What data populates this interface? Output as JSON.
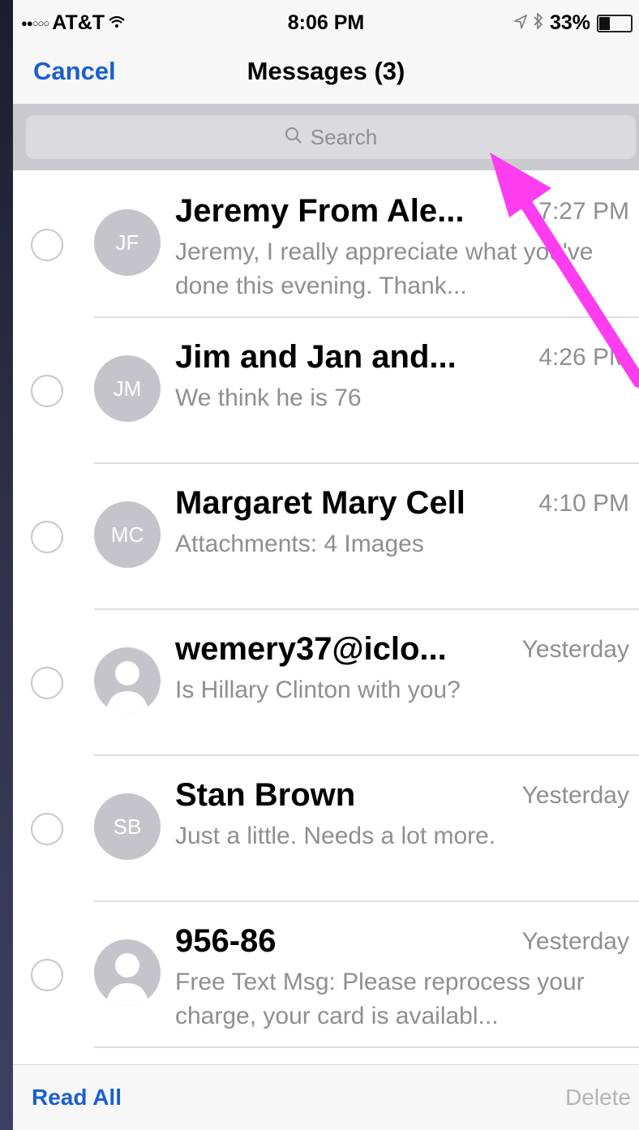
{
  "status_bar": {
    "signal": "●●○○○",
    "carrier": "AT&T",
    "time": "8:06 PM",
    "battery_percent": "33%",
    "battery_level": 0.33
  },
  "nav": {
    "cancel": "Cancel",
    "title": "Messages (3)"
  },
  "search": {
    "placeholder": "Search"
  },
  "conversations": [
    {
      "initials": "JF",
      "name": "Jeremy From Ale...",
      "time": "7:27 PM",
      "preview": "Jeremy, I really appreciate what you've done this evening. Thank..."
    },
    {
      "initials": "JM",
      "name": "Jim and Jan and...",
      "time": "4:26 PM",
      "preview": "We think he is 76"
    },
    {
      "initials": "MC",
      "name": "Margaret Mary Cell",
      "time": "4:10 PM",
      "preview": "Attachments: 4 Images"
    },
    {
      "initials": "",
      "name": "wemery37@iclo...",
      "time": "Yesterday",
      "preview": "Is Hillary Clinton with you?"
    },
    {
      "initials": "SB",
      "name": "Stan Brown",
      "time": "Yesterday",
      "preview": "Just a little.  Needs a lot more."
    },
    {
      "initials": "",
      "name": "956-86",
      "time": "Yesterday",
      "preview": "Free Text Msg: Please reprocess your charge, your card is availabl..."
    }
  ],
  "toolbar": {
    "read_all": "Read All",
    "delete": "Delete"
  },
  "colors": {
    "accent": "#1a5fd0",
    "annotation_arrow": "#ff3cf0"
  }
}
